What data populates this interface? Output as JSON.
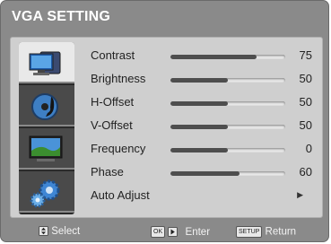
{
  "menu": {
    "title": "VGA SETTING"
  },
  "settings": [
    {
      "label": "Contrast",
      "value": "75",
      "level": 0.75
    },
    {
      "label": "Brightness",
      "value": "50",
      "level": 0.5
    },
    {
      "label": "H-Offset",
      "value": "50",
      "level": 0.5
    },
    {
      "label": "V-Offset",
      "value": "50",
      "level": 0.5
    },
    {
      "label": "Frequency",
      "value": "0",
      "level": 0.5
    },
    {
      "label": "Phase",
      "value": "60",
      "level": 0.6
    },
    {
      "label": "Auto Adjust",
      "action_icon": "right-triangle-icon"
    }
  ],
  "sidebar": {
    "tabs": [
      {
        "icon": "computer-monitor-icon",
        "active": true
      },
      {
        "icon": "audio-disc-icon",
        "active": false
      },
      {
        "icon": "tv-screen-icon",
        "active": false
      },
      {
        "icon": "gears-settings-icon",
        "active": false
      }
    ]
  },
  "footer": {
    "select_label": "Select",
    "ok_key": "OK",
    "enter_label": "Enter",
    "setup_key": "SETUP",
    "return_label": "Return"
  },
  "colors": {
    "frame": "#8a8a8a",
    "panel": "#cfcfcf",
    "sidebar": "#2a2a2a",
    "fill": "#4e4e4e"
  }
}
